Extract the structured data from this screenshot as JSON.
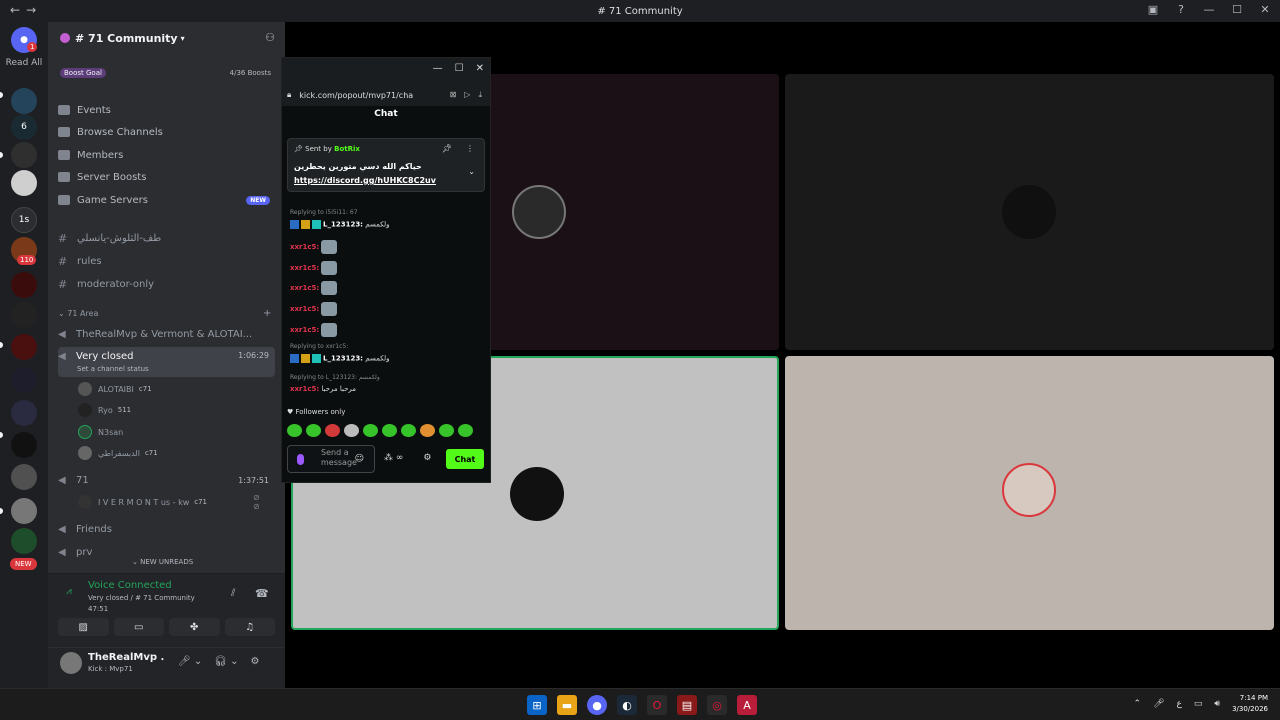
{
  "window": {
    "title": "# 71 Community",
    "nav_back": "←",
    "nav_fwd": "→",
    "icons": [
      "inbox-icon",
      "help-icon",
      "minimize-icon",
      "maximize-icon",
      "close-icon"
    ]
  },
  "rail": {
    "read_all": "Read All",
    "badge_top": "1",
    "servers_badges": [
      "1",
      "1s",
      "110",
      "1",
      "NEW"
    ]
  },
  "server": {
    "name": "# 71 Community",
    "boost_label": "Boost Goal",
    "boost_count": "4/36 Boosts"
  },
  "menu": [
    {
      "label": "Events"
    },
    {
      "label": "Browse Channels"
    },
    {
      "label": "Members"
    },
    {
      "label": "Server Boosts"
    },
    {
      "label": "Game Servers",
      "badge": "NEW"
    }
  ],
  "channels": [
    "طف-الثلوش-يانسلي",
    "rules",
    "moderator-only"
  ],
  "category": "71 Area",
  "voice_channels": {
    "vc1": {
      "name": "TheRealMvp & Vermont & ALOTAI..."
    },
    "active": {
      "name": "Very closed",
      "time": "1:06:29",
      "status": "Set a channel status"
    },
    "users": [
      {
        "name": "ALOTAIBI",
        "tag": "c71"
      },
      {
        "name": "Ryo",
        "tag": "511"
      },
      {
        "name": "N3san",
        "tag": ""
      },
      {
        "name": "الدبسفراطي",
        "tag": "c71"
      }
    ],
    "vc3": {
      "name": "71",
      "time": "1:37:51"
    },
    "vc3_user": {
      "name": "I V E R M O N T us - kw",
      "tag": "c71"
    },
    "vc4": {
      "name": "Friends"
    },
    "vc5": {
      "name": "prv"
    }
  },
  "new_unreads": "NEW UNREADS",
  "voice_panel": {
    "title": "Voice Connected",
    "sub": "Very closed / # 71 Community",
    "time": "47:51"
  },
  "user_panel": {
    "name": "TheRealMvp .",
    "status": "Kick : Mvp71"
  },
  "popout": {
    "url": "kick.com/popout/mvp71/cha",
    "title": "Chat",
    "pinned_sent_by": "Sent by",
    "pinned_user": "BotRix",
    "pinned_msg": "حياكم الله دسي متورين يحطرين",
    "pinned_link": "https://discord.gg/hUHKC8C2uv",
    "reply1": "Replying to i5i5i11: 67",
    "msg1_user": "L_123123:",
    "msg1_text": "ولكمسم",
    "xxr_user": "xxr1c5:",
    "reply2": "Replying to xxr1c5:",
    "msg2_user": "L_123123:",
    "msg2_text": "ولكمسم",
    "reply3": "Replying to L_123123: ولكمسم",
    "msg3_user": "xxr1c5:",
    "msg3_text": "مرحبا مرحبا",
    "followers_only": "Followers only",
    "send_placeholder": "Send a message",
    "chat_button": "Chat"
  },
  "taskbar": {
    "time": "7:14 PM",
    "date": "3/30/2026",
    "lang": "ع"
  }
}
